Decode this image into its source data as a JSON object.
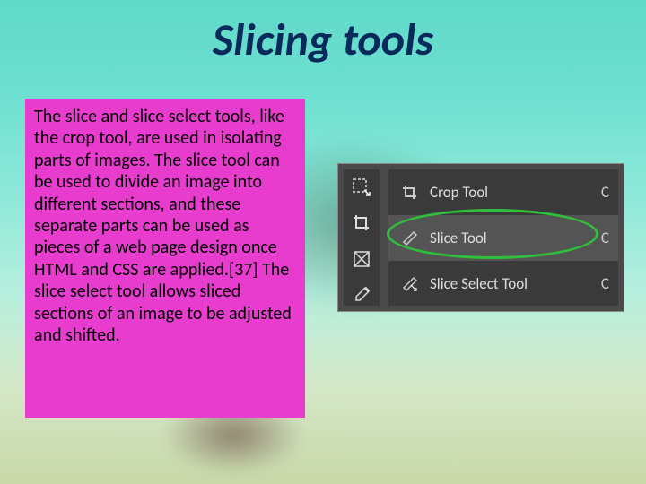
{
  "title": "Slicing tools",
  "body_text": "The slice and slice select tools, like the crop tool, are used in isolating parts of images. The slice tool can be used to divide an image into different sections, and these separate parts can be used as pieces of a web page design once HTML and CSS are applied.[37] The slice select tool allows sliced sections of an image to be adjusted and shifted.",
  "panel": {
    "rows": [
      {
        "label": "Crop Tool",
        "key": "C"
      },
      {
        "label": "Slice Tool",
        "key": "C"
      },
      {
        "label": "Slice Select Tool",
        "key": "C"
      }
    ]
  }
}
